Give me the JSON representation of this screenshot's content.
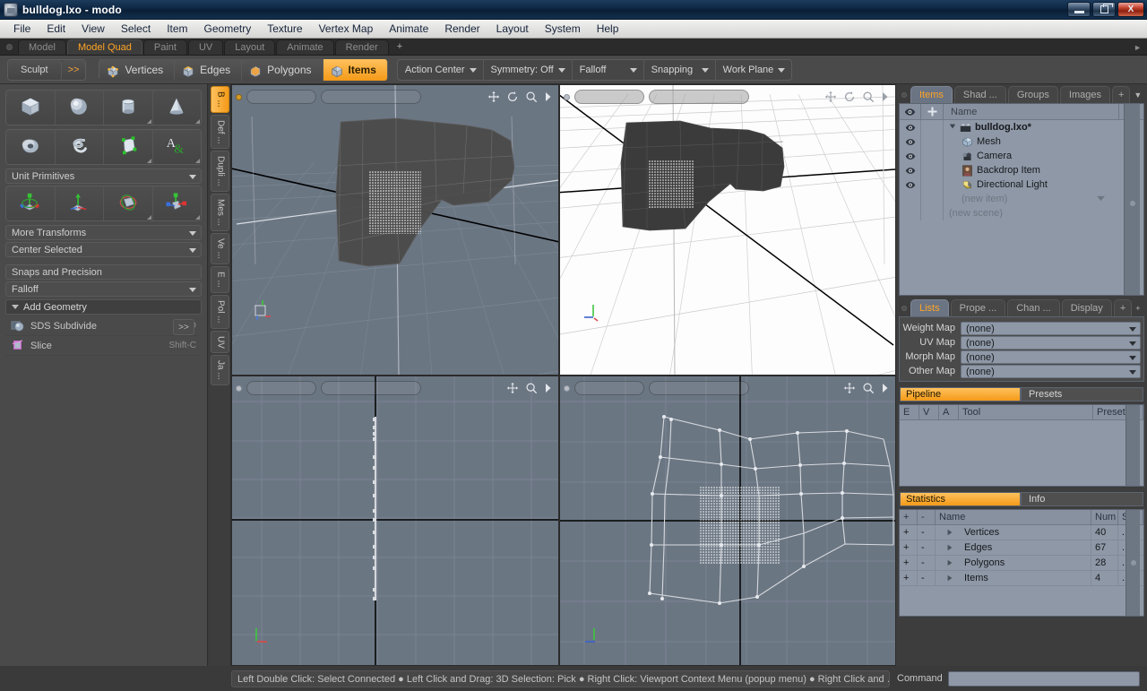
{
  "window": {
    "title": "bulldog.lxo - modo",
    "app_icon": "modo-app-icon",
    "buttons": {
      "minimize": "minimize",
      "restore": "restore",
      "close": "X"
    }
  },
  "menubar": {
    "items": [
      "File",
      "Edit",
      "View",
      "Select",
      "Item",
      "Geometry",
      "Texture",
      "Vertex Map",
      "Animate",
      "Render",
      "Layout",
      "System",
      "Help"
    ]
  },
  "layout_tabs": {
    "items": [
      "Model",
      "Model Quad",
      "Paint",
      "UV",
      "Layout",
      "Animate",
      "Render"
    ],
    "active": "Model Quad",
    "add_label": "+"
  },
  "toolbar": {
    "sculpt_label": "Sculpt",
    "expand_label": ">>",
    "modes": [
      {
        "label": "Vertices",
        "icon": "cube-vertices-icon",
        "active": false
      },
      {
        "label": "Edges",
        "icon": "cube-edges-icon",
        "active": false
      },
      {
        "label": "Polygons",
        "icon": "cube-polygons-icon",
        "active": false
      },
      {
        "label": "Items",
        "icon": "cube-items-icon",
        "active": true
      }
    ],
    "dropdowns": [
      "Action Center",
      "Symmetry: Off",
      "Falloff",
      "Snapping",
      "Work Plane"
    ]
  },
  "left_panel": {
    "primitives_row1": [
      {
        "name": "cube-primitive",
        "label": "Cube"
      },
      {
        "name": "sphere-primitive",
        "label": "Sphere"
      },
      {
        "name": "cylinder-primitive",
        "label": "Cylinder"
      },
      {
        "name": "cone-primitive",
        "label": "Cone"
      }
    ],
    "primitives_row2": [
      {
        "name": "torus-primitive",
        "label": "Torus"
      },
      {
        "name": "spiral-primitive",
        "label": "Spiral"
      },
      {
        "name": "pen-primitive",
        "label": "Pen"
      },
      {
        "name": "text-primitive",
        "label": "Text"
      }
    ],
    "unit_primitives_label": "Unit Primitives",
    "transform_items": [
      {
        "name": "move-transform",
        "label": "Move"
      },
      {
        "name": "rotate-transform",
        "label": "Rotate"
      },
      {
        "name": "scale-transform",
        "label": "Scale"
      },
      {
        "name": "transform-tool",
        "label": "Transform"
      }
    ],
    "more_transforms_label": "More Transforms",
    "center_selected_label": "Center Selected",
    "snaps_label": "Snaps and Precision",
    "falloff_label": "Falloff",
    "add_geometry_label": "Add Geometry",
    "tools": [
      {
        "label": "SDS Subdivide",
        "shortcut": "D",
        "icon": "sds-subdivide-icon"
      },
      {
        "label": "Slice",
        "shortcut": "Shift-C",
        "icon": "slice-icon"
      }
    ],
    "expand_label": ">>"
  },
  "vertical_tabs": {
    "items": [
      "B ...",
      "Def ...",
      "Dupli ...",
      "Mes ...",
      "Ve ...",
      "E ...",
      "Pol ...",
      "UV",
      "Ja ..."
    ],
    "active": "B ..."
  },
  "viewports": [
    {
      "name": "perspective-viewport",
      "style": "shaded",
      "bg": "dark"
    },
    {
      "name": "top-viewport",
      "style": "shaded",
      "bg": "light"
    },
    {
      "name": "front-viewport",
      "style": "wireframe",
      "bg": "dark"
    },
    {
      "name": "side-viewport",
      "style": "wireframe",
      "bg": "dark"
    }
  ],
  "viewport_icons": [
    "move-icon",
    "rotate-icon",
    "zoom-icon",
    "more-arrow-icon"
  ],
  "right_panel": {
    "top_tabs": {
      "items": [
        "Items",
        "Shad ...",
        "Groups",
        "Images"
      ],
      "active": "Items",
      "more": "+"
    },
    "item_tree": {
      "columns": [
        "Name"
      ],
      "rows": [
        {
          "label": "bulldog.lxo*",
          "icon": "scene-icon",
          "indent": 0,
          "root": true,
          "eye": true,
          "muted": false
        },
        {
          "label": "Mesh",
          "icon": "mesh-icon",
          "indent": 1,
          "root": false,
          "eye": true,
          "muted": false
        },
        {
          "label": "Camera",
          "icon": "camera-icon",
          "indent": 1,
          "root": false,
          "eye": true,
          "muted": false
        },
        {
          "label": "Backdrop Item",
          "icon": "backdrop-icon",
          "indent": 1,
          "root": false,
          "eye": true,
          "muted": false
        },
        {
          "label": "Directional Light",
          "icon": "light-icon",
          "indent": 1,
          "root": false,
          "eye": true,
          "muted": false
        },
        {
          "label": "(new item)",
          "icon": "",
          "indent": 1,
          "root": false,
          "eye": false,
          "muted": true
        },
        {
          "label": "(new scene)",
          "icon": "",
          "indent": 0,
          "root": false,
          "eye": false,
          "muted": true
        }
      ]
    },
    "mid_tabs": {
      "items": [
        "Lists",
        "Prope ...",
        "Chan ...",
        "Display"
      ],
      "active": "Lists",
      "more": "+"
    },
    "maps": [
      {
        "label": "Weight Map",
        "value": "(none)"
      },
      {
        "label": "UV Map",
        "value": "(none)"
      },
      {
        "label": "Morph Map",
        "value": "(none)"
      },
      {
        "label": "Other Map",
        "value": "(none)"
      }
    ],
    "pipeline": {
      "tabs": [
        "Pipeline",
        "Presets"
      ],
      "active": "Pipeline",
      "columns": [
        "E",
        "V",
        "A",
        "Tool",
        "Preset"
      ],
      "rows": []
    },
    "statistics": {
      "tabs": [
        "Statistics",
        "Info"
      ],
      "active": "Statistics",
      "columns": [
        "+",
        "-",
        "Name",
        "Num",
        "Sel"
      ],
      "rows": [
        {
          "name": "Vertices",
          "num": "40",
          "sel": "..."
        },
        {
          "name": "Edges",
          "num": "67",
          "sel": "..."
        },
        {
          "name": "Polygons",
          "num": "28",
          "sel": "..."
        },
        {
          "name": "Items",
          "num": "4",
          "sel": "..."
        }
      ]
    }
  },
  "statusbar": {
    "hint": "Left Double Click: Select Connected ● Left Click and Drag: 3D Selection: Pick ● Right Click: Viewport Context Menu (popup menu) ● Right Click and …",
    "command_label": "Command",
    "command_value": ""
  },
  "colors": {
    "accent": "#f49a18",
    "panel": "#4a4a4a",
    "viewport_dark": "#6b7683",
    "viewport_light": "#fdfdfd",
    "titlebar": "#0d2744"
  }
}
